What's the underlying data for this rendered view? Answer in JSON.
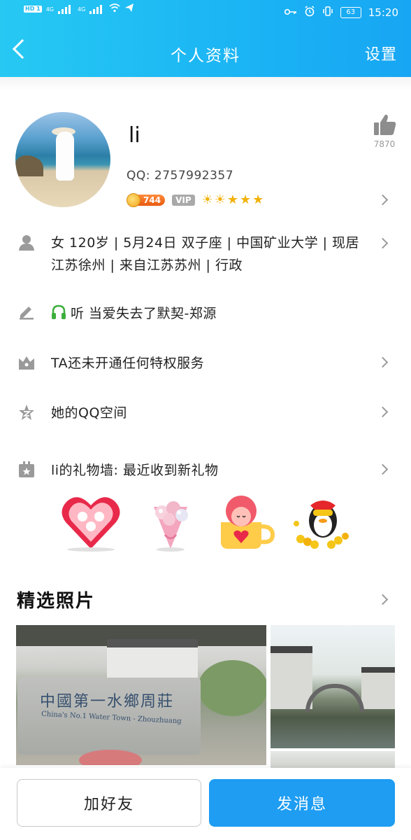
{
  "status_bar": {
    "sim1": "HD 1",
    "sim2": "HD 2",
    "net1": "4G",
    "net2": "4G",
    "battery": "63",
    "time": "15:20"
  },
  "header": {
    "title": "个人资料",
    "settings_label": "设置"
  },
  "profile": {
    "name": "li",
    "qq_label": "QQ: 2757992357",
    "coin_value": "744",
    "vip_label": "VIP",
    "likes": "7870"
  },
  "rows": {
    "info": "女  120岁 | 5月24日  双子座 | 中国矿业大学 | 现居江苏徐州 | 来自江苏苏州 | 行政",
    "signature": "听 当爱失去了默契-郑源",
    "privilege": "TA还未开通任何特权服务",
    "qzone": "她的QQ空间",
    "gift_wall": "li的礼物墙: 最近收到新礼物"
  },
  "photos": {
    "section_title": "精选照片",
    "stone_cn": "中國第一水鄉周莊",
    "stone_en": "China's No.1 Water Town - Zhouzhuang"
  },
  "actions": {
    "add_friend": "加好友",
    "send_message": "发消息"
  },
  "colors": {
    "header_start": "#27c9f3",
    "header_end": "#17a6f3",
    "primary_button": "#1e9df2"
  }
}
